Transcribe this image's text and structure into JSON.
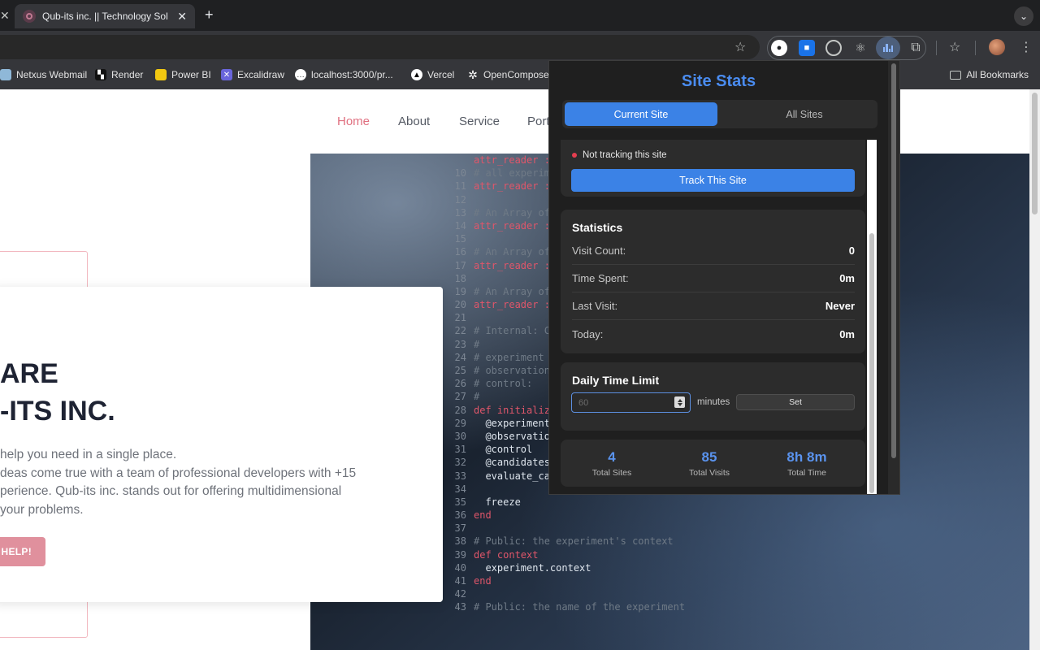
{
  "browser": {
    "tab_title": "Qub-its inc. || Technology Sol",
    "new_tab": "+",
    "close": "✕",
    "bookmarks": [
      {
        "label": "Netxus Webmail"
      },
      {
        "label": "Render"
      },
      {
        "label": "Power BI"
      },
      {
        "label": "Excalidraw"
      },
      {
        "label": "localhost:3000/pr..."
      },
      {
        "label": "Vercel"
      },
      {
        "label": "OpenCompose"
      }
    ],
    "all_bookmarks": "All Bookmarks"
  },
  "site": {
    "nav": [
      {
        "label": "Home"
      },
      {
        "label": "About"
      },
      {
        "label": "Service"
      },
      {
        "label": "Port"
      }
    ],
    "hero_title": [
      "ARE",
      "-ITS INC."
    ],
    "hero_text": [
      "help you need in a single place.",
      "deas come true with a team of professional developers with +15",
      "perience. Qub-its inc. stands out for offering multidimensional",
      " your problems."
    ],
    "hero_button": "H HELP!",
    "code_lines": [
      {
        "n": "",
        "t": "attr_reader :c"
      },
      {
        "n": "10",
        "t": "# all experiment"
      },
      {
        "n": "11",
        "t": "attr_reader :e"
      },
      {
        "n": "12",
        "t": ""
      },
      {
        "n": "13",
        "t": "# An Array of"
      },
      {
        "n": "14",
        "t": "attr_reader :o"
      },
      {
        "n": "15",
        "t": ""
      },
      {
        "n": "16",
        "t": "# An Array of"
      },
      {
        "n": "17",
        "t": "attr_reader :m"
      },
      {
        "n": "18",
        "t": ""
      },
      {
        "n": "19",
        "t": "# An Array of"
      },
      {
        "n": "20",
        "t": "attr_reader :ob"
      },
      {
        "n": "21",
        "t": ""
      },
      {
        "n": "22",
        "t": "# Internal: Cre"
      },
      {
        "n": "23",
        "t": "#"
      },
      {
        "n": "24",
        "t": "# experiment"
      },
      {
        "n": "25",
        "t": "# observations"
      },
      {
        "n": "26",
        "t": "# control:"
      },
      {
        "n": "27",
        "t": "#"
      },
      {
        "n": "28",
        "t": "def initialize"
      },
      {
        "n": "29",
        "t": "  @experiment"
      },
      {
        "n": "30",
        "t": "  @observations"
      },
      {
        "n": "31",
        "t": "  @control"
      },
      {
        "n": "32",
        "t": "  @candidates  = observations - [control]"
      },
      {
        "n": "33",
        "t": "  evaluate_candidates"
      },
      {
        "n": "34",
        "t": ""
      },
      {
        "n": "35",
        "t": "  freeze"
      },
      {
        "n": "36",
        "t": "end"
      },
      {
        "n": "37",
        "t": ""
      },
      {
        "n": "38",
        "t": "# Public: the experiment's context"
      },
      {
        "n": "39",
        "t": "def context"
      },
      {
        "n": "40",
        "t": "  experiment.context"
      },
      {
        "n": "41",
        "t": "end"
      },
      {
        "n": "42",
        "t": ""
      },
      {
        "n": "43",
        "t": "# Public: the name of the experiment"
      }
    ]
  },
  "popup": {
    "title": "Site Stats",
    "tabs": {
      "current": "Current Site",
      "all": "All Sites"
    },
    "status": "Not tracking this site",
    "track_button": "Track This Site",
    "statistics": {
      "title": "Statistics",
      "rows": [
        {
          "label": "Visit Count:",
          "value": "0"
        },
        {
          "label": "Time Spent:",
          "value": "0m"
        },
        {
          "label": "Last Visit:",
          "value": "Never"
        },
        {
          "label": "Today:",
          "value": "0m"
        }
      ]
    },
    "limit": {
      "title": "Daily Time Limit",
      "placeholder": "60",
      "unit": "minutes",
      "set_button": "Set"
    },
    "totals": [
      {
        "value": "4",
        "label": "Total Sites"
      },
      {
        "value": "85",
        "label": "Total Visits"
      },
      {
        "value": "8h 8m",
        "label": "Total Time"
      }
    ],
    "colors": {
      "accent": "#3b82e6",
      "status_off": "#e53e4f",
      "background": "#1f1f1f"
    }
  }
}
